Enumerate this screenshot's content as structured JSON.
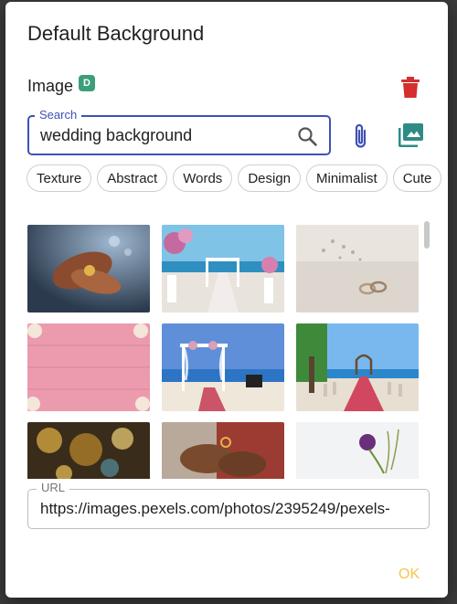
{
  "dialog": {
    "title": "Default Background",
    "image_label": "Image",
    "badge": "D",
    "ok_label": "OK"
  },
  "search": {
    "legend": "Search",
    "value": "wedding background"
  },
  "chips": [
    "Texture",
    "Abstract",
    "Words",
    "Design",
    "Minimalist",
    "Cute"
  ],
  "url": {
    "legend": "URL",
    "value": "https://images.pexels.com/photos/2395249/pexels-"
  },
  "colors": {
    "accent": "#3f51b5",
    "delete": "#d32f2f",
    "teal": "#2e8b86",
    "ok": "#f5c54a",
    "badge": "#3c9f7a"
  },
  "icons": [
    "delete-icon",
    "search-icon",
    "paperclip-icon",
    "photo-library-icon"
  ],
  "thumbnails": [
    "henna-hands-bokeh",
    "beach-aisle-flowers",
    "rings-white-flowers",
    "pink-wood-flowers",
    "beach-arch-ceremony",
    "palm-red-carpet-aisle",
    "golden-bokeh",
    "ring-exchange",
    "purple-flower-white"
  ]
}
